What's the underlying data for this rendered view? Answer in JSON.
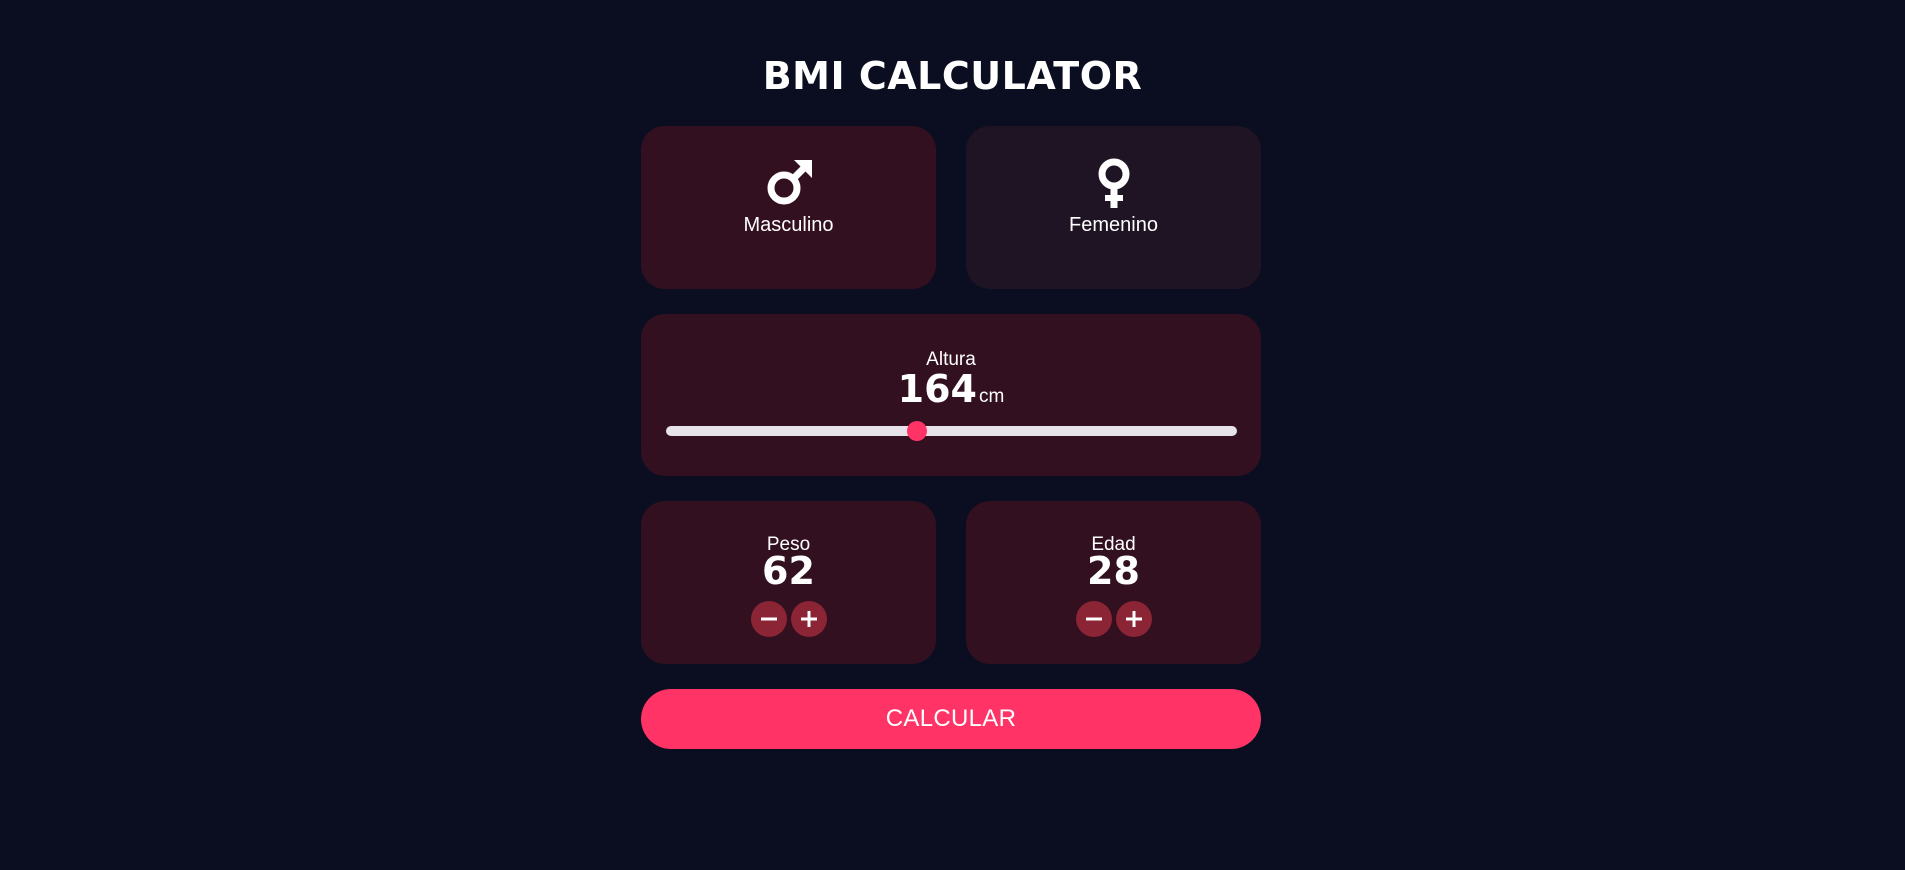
{
  "app": {
    "title": "BMI CALCULATOR",
    "accent_color": "#ff3366",
    "background_color": "#0a0e20"
  },
  "gender": {
    "male": {
      "label": "Masculino",
      "icon": "male-symbol-icon",
      "selected": true
    },
    "female": {
      "label": "Femenino",
      "icon": "female-symbol-icon",
      "selected": false
    }
  },
  "height": {
    "label": "Altura",
    "value": "164",
    "unit": "cm",
    "slider_min": 120,
    "slider_max": 220,
    "slider_value": 164
  },
  "weight": {
    "label": "Peso",
    "value": "62",
    "decrement_icon": "minus-icon",
    "increment_icon": "plus-icon"
  },
  "age": {
    "label": "Edad",
    "value": "28",
    "decrement_icon": "minus-icon",
    "increment_icon": "plus-icon"
  },
  "calculate_button": {
    "label": "CALCULAR"
  }
}
